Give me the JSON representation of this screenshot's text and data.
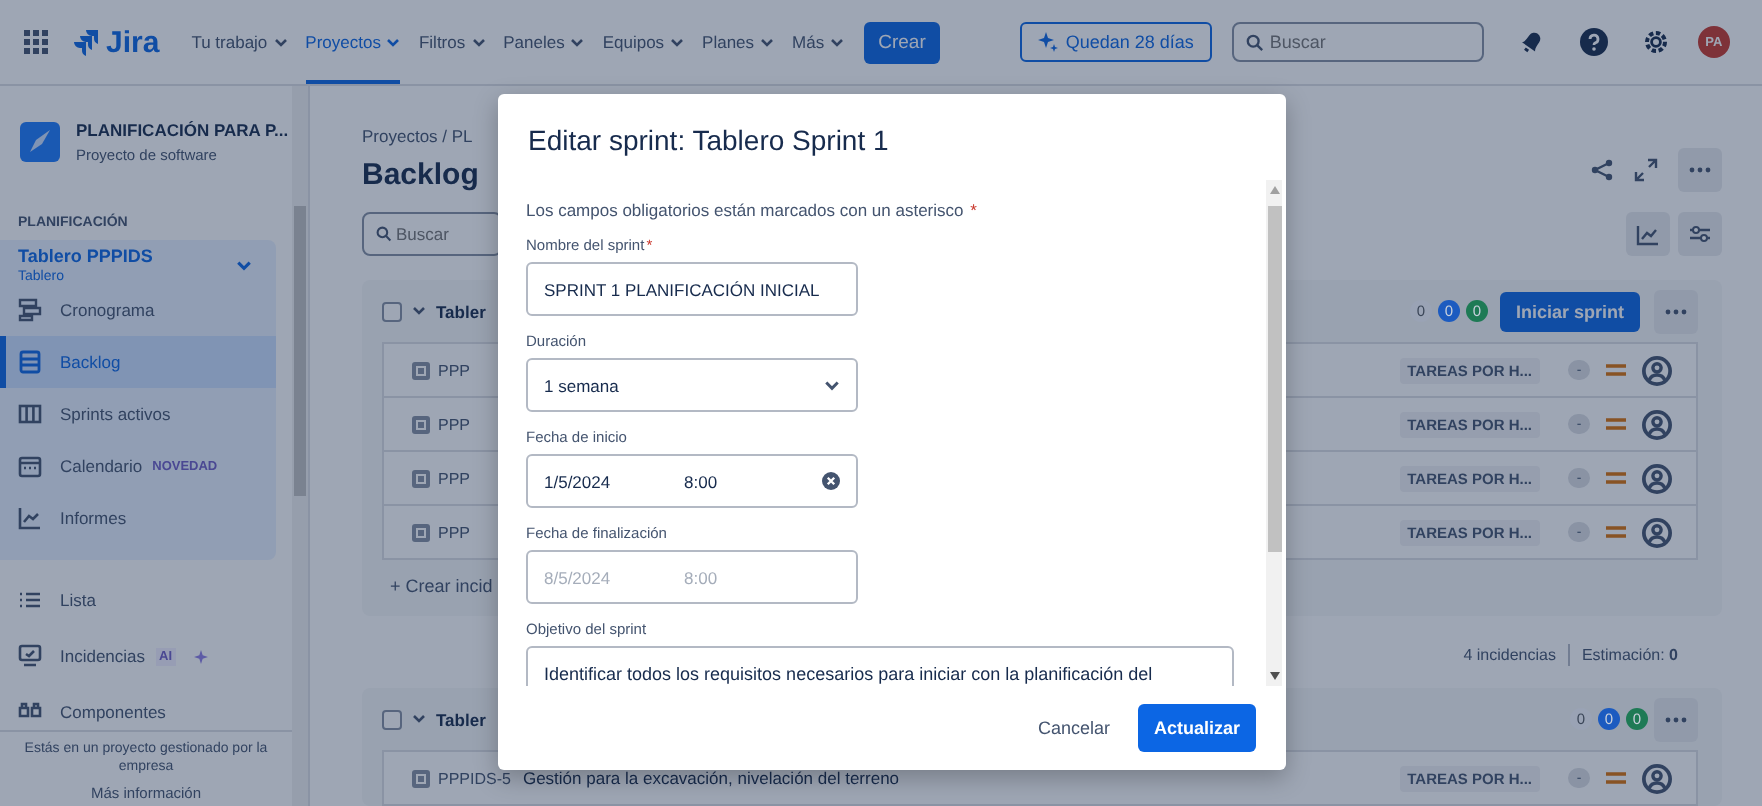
{
  "nav": {
    "product": "Jira",
    "menu": [
      {
        "label": "Tu trabajo",
        "selected": false
      },
      {
        "label": "Proyectos",
        "selected": true
      },
      {
        "label": "Filtros",
        "selected": false
      },
      {
        "label": "Paneles",
        "selected": false
      },
      {
        "label": "Equipos",
        "selected": false
      },
      {
        "label": "Planes",
        "selected": false
      },
      {
        "label": "Más",
        "selected": false
      }
    ],
    "create": "Crear",
    "trial": "Quedan 28 días",
    "search": {
      "placeholder": "Buscar"
    },
    "avatar": "PA"
  },
  "sidebar": {
    "project": {
      "name": "PLANIFICACIÓN PARA P...",
      "type": "Proyecto de software"
    },
    "section": "PLANIFICACIÓN",
    "board": {
      "name": "Tablero PPPIDS",
      "sub": "Tablero"
    },
    "group": [
      {
        "label": "Cronograma",
        "selected": false
      },
      {
        "label": "Backlog",
        "selected": true
      },
      {
        "label": "Sprints activos",
        "selected": false
      },
      {
        "label": "Calendario",
        "selected": false,
        "badge": "NOVEDAD"
      },
      {
        "label": "Informes",
        "selected": false
      }
    ],
    "items": [
      {
        "label": "Lista",
        "selected": false
      },
      {
        "label": "Incidencias",
        "selected": false,
        "badge": "AI"
      },
      {
        "label": "Componentes",
        "selected": false
      }
    ],
    "footer": {
      "text": "Estás en un proyecto gestionado por la empresa",
      "link": "Más información"
    }
  },
  "main": {
    "breadcrumb": "Proyectos / PL",
    "title": "Backlog",
    "search": {
      "placeholder": "Buscar"
    },
    "sprints": [
      {
        "name": "Tabler",
        "checked": false,
        "counts": [
          {
            "value": "0",
            "color": "#9aa3b5"
          },
          {
            "value": "0",
            "color": "#1c5bc0"
          },
          {
            "value": "0",
            "color": "#1e7a55"
          }
        ],
        "action": "Iniciar sprint",
        "rows": [
          {
            "key": "PPP",
            "summary": "",
            "epic": "TAREAS POR H...",
            "estimate": "-"
          },
          {
            "key": "PPP",
            "summary": "",
            "epic": "TAREAS POR H...",
            "estimate": "-"
          },
          {
            "key": "PPP",
            "summary": "",
            "epic": "TAREAS POR H...",
            "estimate": "-"
          },
          {
            "key": "PPP",
            "summary": "",
            "epic": "TAREAS POR H...",
            "estimate": "-"
          }
        ],
        "create": "+ Crear incid",
        "issues": "4 incidencias",
        "estimate_label": "Estimación:",
        "estimate_value": "0"
      },
      {
        "name": "Tabler",
        "checked": false,
        "counts": [
          {
            "value": "0",
            "color": "#9aa3b5"
          },
          {
            "value": "0",
            "color": "#1c5bc0"
          },
          {
            "value": "0",
            "color": "#1e7a55"
          }
        ],
        "rows": [
          {
            "key": "PPPIDS-5",
            "summary": "Gestión para la excavación, nivelación del terreno",
            "epic": "TAREAS POR H...",
            "estimate": "-"
          }
        ]
      }
    ]
  },
  "modal": {
    "title": "Editar sprint: Tablero Sprint 1",
    "note": "Los campos obligatorios están marcados con un asterisco",
    "required_mark": "*",
    "fields": [
      {
        "kind": "text",
        "label": "Nombre del sprint",
        "required": true,
        "value": "SPRINT 1 PLANIFICACIÓN INICIAL"
      },
      {
        "kind": "select",
        "label": "Duración",
        "required": false,
        "value": "1 semana"
      },
      {
        "kind": "datetime",
        "label": "Fecha de inicio",
        "required": false,
        "date": "1/5/2024",
        "time": "8:00",
        "disabled": false
      },
      {
        "kind": "datetime",
        "label": "Fecha de finalización",
        "required": false,
        "date": "8/5/2024",
        "time": "8:00",
        "disabled": true
      },
      {
        "kind": "textarea",
        "label": "Objetivo del sprint",
        "required": false,
        "value": "Identificar todos los requisitos necesarios para iniciar con la planificación del"
      }
    ],
    "cancel": "Cancelar",
    "submit": "Actualizar"
  }
}
